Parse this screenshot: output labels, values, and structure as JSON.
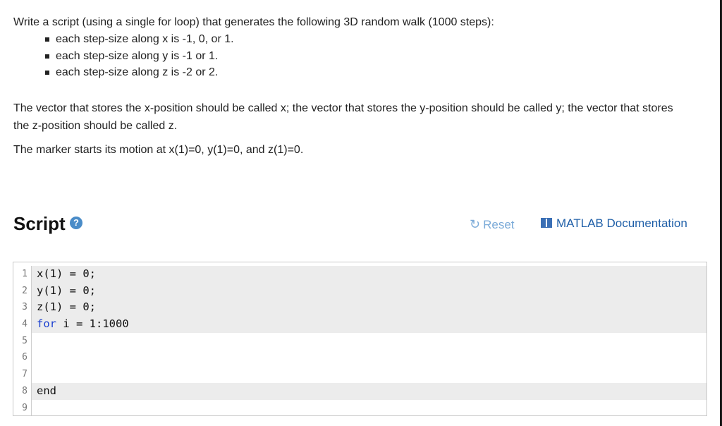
{
  "problem": {
    "intro": "Write a script (using a single for loop) that generates the following 3D random walk (1000 steps):",
    "bullets": [
      "each step-size along x is -1, 0, or 1.",
      "each step-size along y is -1 or 1.",
      "each step-size along z is -2 or 2."
    ],
    "paragraph2": "The vector that stores the x-position should be called x; the vector that stores the y-position should be called y; the vector that stores the z-position should be called z.",
    "paragraph3": "The marker starts its motion at x(1)=0, y(1)=0, and z(1)=0."
  },
  "script_header": {
    "title": "Script",
    "help_icon": "?",
    "reset_label": "Reset",
    "reset_icon": "↻",
    "doc_label": "MATLAB Documentation"
  },
  "editor": {
    "lines": [
      {
        "num": "1",
        "code": "x(1) = 0;",
        "keyword": "",
        "locked": true
      },
      {
        "num": "2",
        "code": "y(1) = 0;",
        "keyword": "",
        "locked": true
      },
      {
        "num": "3",
        "code": "z(1) = 0;",
        "keyword": "",
        "locked": true
      },
      {
        "num": "4",
        "code": " i = 1:1000",
        "keyword": "for",
        "locked": true
      },
      {
        "num": "5",
        "code": "",
        "keyword": "",
        "locked": false
      },
      {
        "num": "6",
        "code": "",
        "keyword": "",
        "locked": false
      },
      {
        "num": "7",
        "code": "",
        "keyword": "",
        "locked": false
      },
      {
        "num": "8",
        "code": "",
        "keyword": "end",
        "locked": true
      },
      {
        "num": "9",
        "code": "",
        "keyword": "",
        "locked": false
      }
    ]
  },
  "colors": {
    "keyword": "#1a3fd0",
    "link": "#1f5fa8",
    "reset": "#7aaad8",
    "locked_line": "#ececec"
  }
}
